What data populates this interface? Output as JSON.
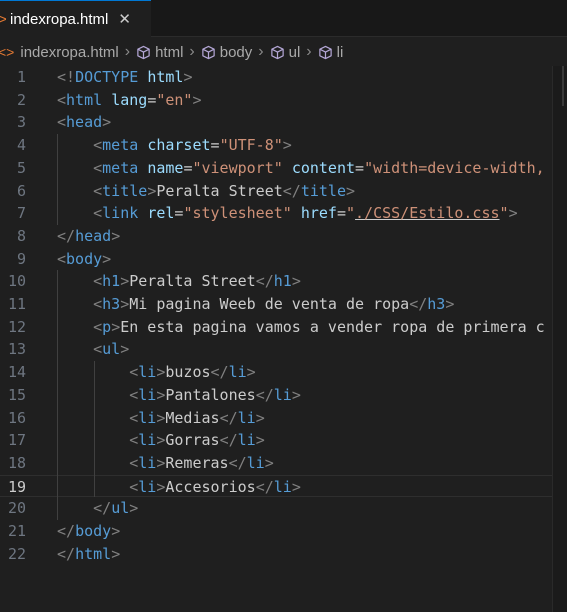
{
  "tab": {
    "filename": "indexropa.html",
    "close_glyph": "✕"
  },
  "breadcrumb": {
    "items": [
      "indexropa.html",
      "html",
      "body",
      "ul",
      "li"
    ]
  },
  "editor": {
    "current_line": 19,
    "lines": [
      [
        [
          "<!",
          "punct"
        ],
        [
          "DOCTYPE",
          "tag"
        ],
        [
          " ",
          "text"
        ],
        [
          "html",
          "attr"
        ],
        [
          ">",
          "punct"
        ]
      ],
      [
        [
          "<",
          "punct"
        ],
        [
          "html",
          "tag"
        ],
        [
          " ",
          "text"
        ],
        [
          "lang",
          "attr"
        ],
        [
          "=",
          "text"
        ],
        [
          "\"en\"",
          "str"
        ],
        [
          ">",
          "punct"
        ]
      ],
      [
        [
          "<",
          "punct"
        ],
        [
          "head",
          "tag"
        ],
        [
          ">",
          "punct"
        ]
      ],
      [
        [
          "    ",
          "text"
        ],
        [
          "<",
          "punct"
        ],
        [
          "meta",
          "tag"
        ],
        [
          " ",
          "text"
        ],
        [
          "charset",
          "attr"
        ],
        [
          "=",
          "text"
        ],
        [
          "\"UTF-8\"",
          "str"
        ],
        [
          ">",
          "punct"
        ]
      ],
      [
        [
          "    ",
          "text"
        ],
        [
          "<",
          "punct"
        ],
        [
          "meta",
          "tag"
        ],
        [
          " ",
          "text"
        ],
        [
          "name",
          "attr"
        ],
        [
          "=",
          "text"
        ],
        [
          "\"viewport\"",
          "str"
        ],
        [
          " ",
          "text"
        ],
        [
          "content",
          "attr"
        ],
        [
          "=",
          "text"
        ],
        [
          "\"width=device-width,",
          "str"
        ]
      ],
      [
        [
          "    ",
          "text"
        ],
        [
          "<",
          "punct"
        ],
        [
          "title",
          "tag"
        ],
        [
          ">",
          "punct"
        ],
        [
          "Peralta Street",
          "text"
        ],
        [
          "</",
          "punct"
        ],
        [
          "title",
          "tag"
        ],
        [
          ">",
          "punct"
        ]
      ],
      [
        [
          "    ",
          "text"
        ],
        [
          "<",
          "punct"
        ],
        [
          "link",
          "tag"
        ],
        [
          " ",
          "text"
        ],
        [
          "rel",
          "attr"
        ],
        [
          "=",
          "text"
        ],
        [
          "\"stylesheet\"",
          "str"
        ],
        [
          " ",
          "text"
        ],
        [
          "href",
          "attr"
        ],
        [
          "=",
          "text"
        ],
        [
          "\"",
          "str"
        ],
        [
          "./CSS/Estilo.css",
          "str-u"
        ],
        [
          "\"",
          "str"
        ],
        [
          ">",
          "punct"
        ]
      ],
      [
        [
          "</",
          "punct"
        ],
        [
          "head",
          "tag"
        ],
        [
          ">",
          "punct"
        ]
      ],
      [
        [
          "<",
          "punct"
        ],
        [
          "body",
          "tag"
        ],
        [
          ">",
          "punct"
        ]
      ],
      [
        [
          "    ",
          "text"
        ],
        [
          "<",
          "punct"
        ],
        [
          "h1",
          "tag"
        ],
        [
          ">",
          "punct"
        ],
        [
          "Peralta Street",
          "text"
        ],
        [
          "</",
          "punct"
        ],
        [
          "h1",
          "tag"
        ],
        [
          ">",
          "punct"
        ]
      ],
      [
        [
          "    ",
          "text"
        ],
        [
          "<",
          "punct"
        ],
        [
          "h3",
          "tag"
        ],
        [
          ">",
          "punct"
        ],
        [
          "Mi pagina Weeb de venta de ropa",
          "text"
        ],
        [
          "</",
          "punct"
        ],
        [
          "h3",
          "tag"
        ],
        [
          ">",
          "punct"
        ]
      ],
      [
        [
          "    ",
          "text"
        ],
        [
          "<",
          "punct"
        ],
        [
          "p",
          "tag"
        ],
        [
          ">",
          "punct"
        ],
        [
          "En esta pagina vamos a vender ropa de primera c",
          "text"
        ]
      ],
      [
        [
          "    ",
          "text"
        ],
        [
          "<",
          "punct"
        ],
        [
          "ul",
          "tag"
        ],
        [
          ">",
          "punct"
        ]
      ],
      [
        [
          "        ",
          "text"
        ],
        [
          "<",
          "punct"
        ],
        [
          "li",
          "tag"
        ],
        [
          ">",
          "punct"
        ],
        [
          "buzos",
          "text"
        ],
        [
          "</",
          "punct"
        ],
        [
          "li",
          "tag"
        ],
        [
          ">",
          "punct"
        ]
      ],
      [
        [
          "        ",
          "text"
        ],
        [
          "<",
          "punct"
        ],
        [
          "li",
          "tag"
        ],
        [
          ">",
          "punct"
        ],
        [
          "Pantalones",
          "text"
        ],
        [
          "</",
          "punct"
        ],
        [
          "li",
          "tag"
        ],
        [
          ">",
          "punct"
        ]
      ],
      [
        [
          "        ",
          "text"
        ],
        [
          "<",
          "punct"
        ],
        [
          "li",
          "tag"
        ],
        [
          ">",
          "punct"
        ],
        [
          "Medias",
          "text"
        ],
        [
          "</",
          "punct"
        ],
        [
          "li",
          "tag"
        ],
        [
          ">",
          "punct"
        ]
      ],
      [
        [
          "        ",
          "text"
        ],
        [
          "<",
          "punct"
        ],
        [
          "li",
          "tag"
        ],
        [
          ">",
          "punct"
        ],
        [
          "Gorras",
          "text"
        ],
        [
          "</",
          "punct"
        ],
        [
          "li",
          "tag"
        ],
        [
          ">",
          "punct"
        ]
      ],
      [
        [
          "        ",
          "text"
        ],
        [
          "<",
          "punct"
        ],
        [
          "li",
          "tag"
        ],
        [
          ">",
          "punct"
        ],
        [
          "Remeras",
          "text"
        ],
        [
          "</",
          "punct"
        ],
        [
          "li",
          "tag"
        ],
        [
          ">",
          "punct"
        ]
      ],
      [
        [
          "        ",
          "text"
        ],
        [
          "<",
          "punct"
        ],
        [
          "li",
          "tag"
        ],
        [
          ">",
          "punct"
        ],
        [
          "Accesorios",
          "text"
        ],
        [
          "</",
          "punct"
        ],
        [
          "li",
          "tag"
        ],
        [
          ">",
          "punct"
        ]
      ],
      [
        [
          "    ",
          "text"
        ],
        [
          "</",
          "punct"
        ],
        [
          "ul",
          "tag"
        ],
        [
          ">",
          "punct"
        ]
      ],
      [
        [
          "</",
          "punct"
        ],
        [
          "body",
          "tag"
        ],
        [
          ">",
          "punct"
        ]
      ],
      [
        [
          "</",
          "punct"
        ],
        [
          "html",
          "tag"
        ],
        [
          ">",
          "punct"
        ]
      ]
    ]
  },
  "colors": {
    "tag": "#569cd6",
    "attribute": "#9cdcfe",
    "string": "#ce9178",
    "punctuation": "#808080",
    "text": "#cccccc",
    "file_icon": "#e37933"
  }
}
